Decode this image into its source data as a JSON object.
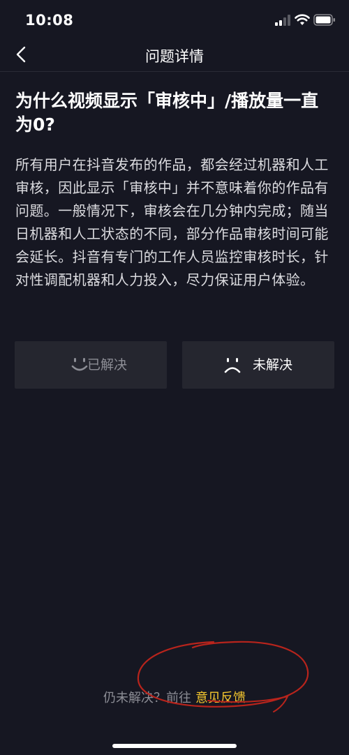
{
  "status_bar": {
    "time": "10:08",
    "icons": [
      "signal-icon",
      "wifi-icon",
      "battery-icon"
    ]
  },
  "nav": {
    "title": "问题详情",
    "back_icon": "chevron-left-icon"
  },
  "question": {
    "title": "为什么视频显示「审核中」/播放量一直为0?",
    "answer": "所有用户在抖音发布的作品，都会经过机器和人工审核，因此显示「审核中」并不意味着你的作品有问题。一般情况下，审核会在几分钟内完成；随当日机器和人工状态的不同，部分作品审核时间可能会延长。抖音有专门的工作人员监控审核时长，针对性调配机器和人力投入，尽力保证用户体验。"
  },
  "feedback_buttons": {
    "resolved": {
      "label": "已解决",
      "icon": "smile-face-icon"
    },
    "unresolved": {
      "label": "未解决",
      "icon": "sad-face-icon"
    }
  },
  "bottom": {
    "prompt": "仍未解决？前往",
    "link": "意见反馈"
  },
  "colors": {
    "background": "#161722",
    "button_bg": "#25262f",
    "link": "#f5c72e",
    "muted_text": "#8c8d95",
    "annotation": "#b8241c"
  }
}
